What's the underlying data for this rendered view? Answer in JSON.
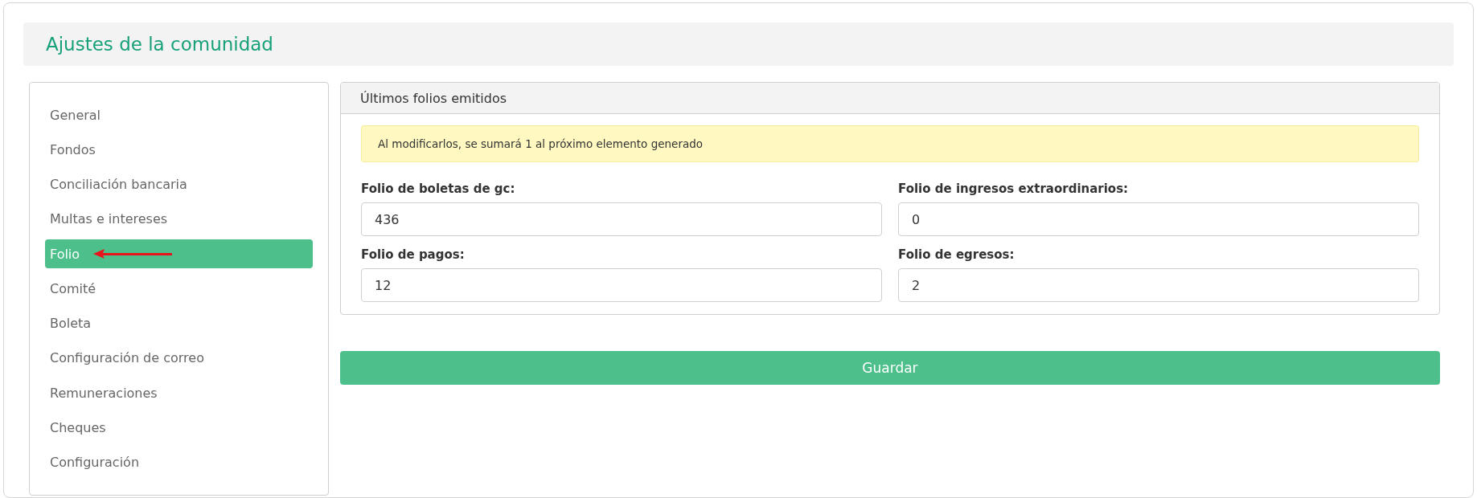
{
  "page": {
    "title": "Ajustes de la comunidad"
  },
  "sidebar": {
    "items": [
      {
        "label": "General",
        "selected": false
      },
      {
        "label": "Fondos",
        "selected": false
      },
      {
        "label": "Conciliación bancaria",
        "selected": false
      },
      {
        "label": "Multas e intereses",
        "selected": false
      },
      {
        "label": "Folio",
        "selected": true
      },
      {
        "label": "Comité",
        "selected": false
      },
      {
        "label": "Boleta",
        "selected": false
      },
      {
        "label": "Configuración de correo",
        "selected": false
      },
      {
        "label": "Remuneraciones",
        "selected": false
      },
      {
        "label": "Cheques",
        "selected": false
      },
      {
        "label": "Configuración",
        "selected": false
      }
    ]
  },
  "panel": {
    "title": "Últimos folios emitidos",
    "notice": "Al modificarlos, se sumará 1 al próximo elemento generado",
    "fields": [
      {
        "label": "Folio de boletas de gc:",
        "value": "436"
      },
      {
        "label": "Folio de ingresos extraordinarios:",
        "value": "0"
      },
      {
        "label": "Folio de pagos:",
        "value": "12"
      },
      {
        "label": "Folio de egresos:",
        "value": "2"
      }
    ]
  },
  "save_button": "Guardar"
}
